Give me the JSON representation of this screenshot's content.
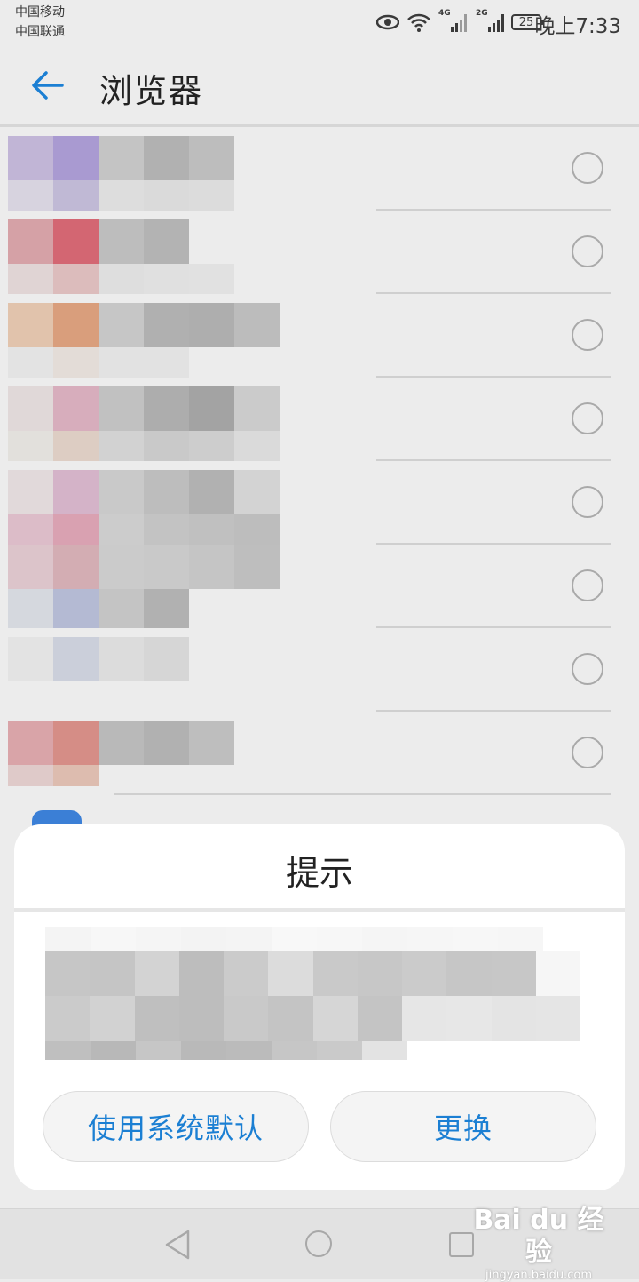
{
  "status_bar": {
    "carrier_1": "中国移动",
    "carrier_2": "中国联通",
    "network_1": "4G",
    "network_2": "2G",
    "battery": "25",
    "time": "晚上7:33"
  },
  "app_bar": {
    "title": "浏览器",
    "back_icon": "arrow-left-icon"
  },
  "list": {
    "item_count": 8,
    "selected_index": null
  },
  "dialog": {
    "title": "提示",
    "use_default_label": "使用系统默认",
    "change_label": "更换"
  },
  "nav_bar": {
    "back_icon": "triangle-back-icon",
    "home_icon": "circle-home-icon",
    "recent_icon": "square-recent-icon"
  },
  "watermark": {
    "logo": "Bai du 经验",
    "url": "jingyan.baidu.com"
  },
  "colors": {
    "accent": "#1b7fd3",
    "overlay_bg": "#ececec",
    "dialog_bg": "#ffffff"
  }
}
